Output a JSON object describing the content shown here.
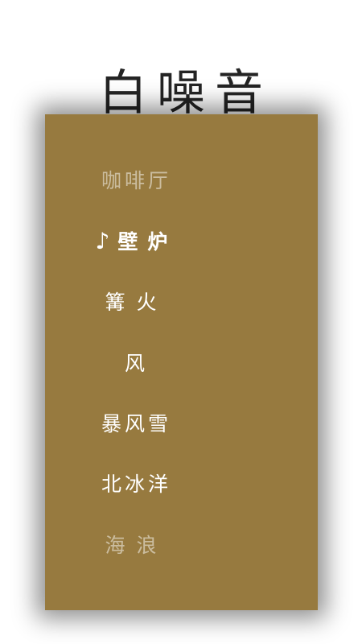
{
  "app": {
    "title": "白噪音"
  },
  "sounds": [
    {
      "label": "咖啡厅",
      "state": "dim"
    },
    {
      "label": "壁炉",
      "state": "playing",
      "icon": "music-note-icon",
      "icon_glyph": "♪"
    },
    {
      "label": "篝火",
      "state": "normal"
    },
    {
      "label": "风",
      "state": "normal"
    },
    {
      "label": "暴风雪",
      "state": "normal"
    },
    {
      "label": "北冰洋",
      "state": "normal"
    },
    {
      "label": "海浪",
      "state": "dim"
    }
  ],
  "colors": {
    "panel_background": "#977a3f",
    "title_text": "#242424",
    "item_text": "#ffffff"
  }
}
